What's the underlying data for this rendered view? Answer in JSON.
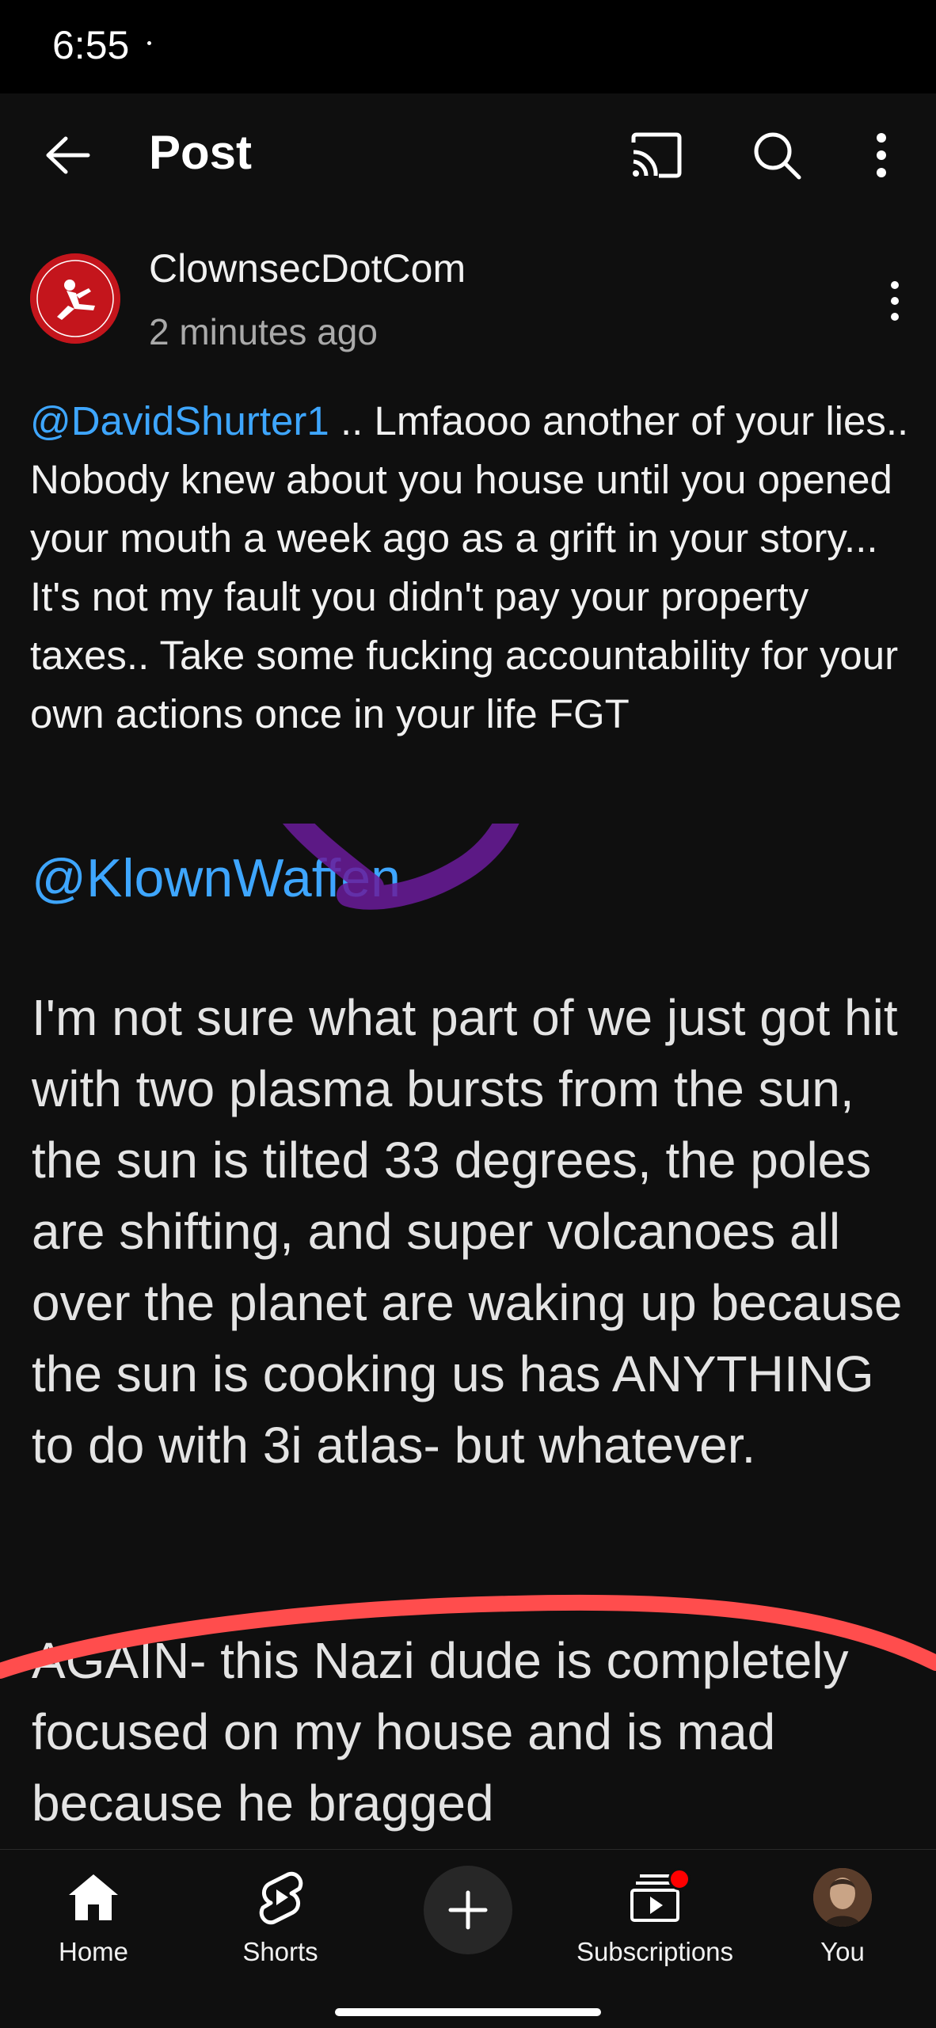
{
  "status_bar": {
    "time": "6:55"
  },
  "header": {
    "title": "Post",
    "icons": {
      "back": "arrow-left-icon",
      "cast": "cast-icon",
      "search": "search-icon",
      "more": "more-vert-icon"
    }
  },
  "post": {
    "channel_name": "ClownsecDotCom",
    "time_ago": "2 minutes ago",
    "text_mention": "@DavidShurter1",
    "text_body": " ..  Lmfaooo another of your lies.. Nobody knew about you house until you opened  your mouth a week ago as a grift in your story... It's not my fault you didn't pay your property taxes.. Take some fucking accountability for your own actions once in your life FGT"
  },
  "embedded_image": {
    "mention": "@KlownWaffen",
    "paragraph1": "I'm not sure what part of we just got hit with two plasma bursts from the sun, the sun is tilted 33 degrees, the poles are shifting, and super volcanoes all over the planet are waking up because the sun is cooking us has ANYTHING to do with 3i atlas- but whatever.",
    "paragraph2": "AGAIN- this Nazi dude is completely focused on my house and is mad because he bragged",
    "colors": {
      "purple_circle": "#6a1b9a",
      "red_line": "#ff4d4d"
    }
  },
  "bottom_nav": {
    "items": [
      {
        "label": "Home",
        "icon": "home-icon"
      },
      {
        "label": "Shorts",
        "icon": "shorts-icon"
      },
      {
        "label": "",
        "icon": "plus-icon"
      },
      {
        "label": "Subscriptions",
        "icon": "subscriptions-icon"
      },
      {
        "label": "You",
        "icon": "avatar-icon"
      }
    ]
  },
  "colors": {
    "background": "#0f0f0f",
    "link": "#3ea6ff",
    "secondary_text": "#aaaaaa",
    "badge": "#ff0000"
  }
}
